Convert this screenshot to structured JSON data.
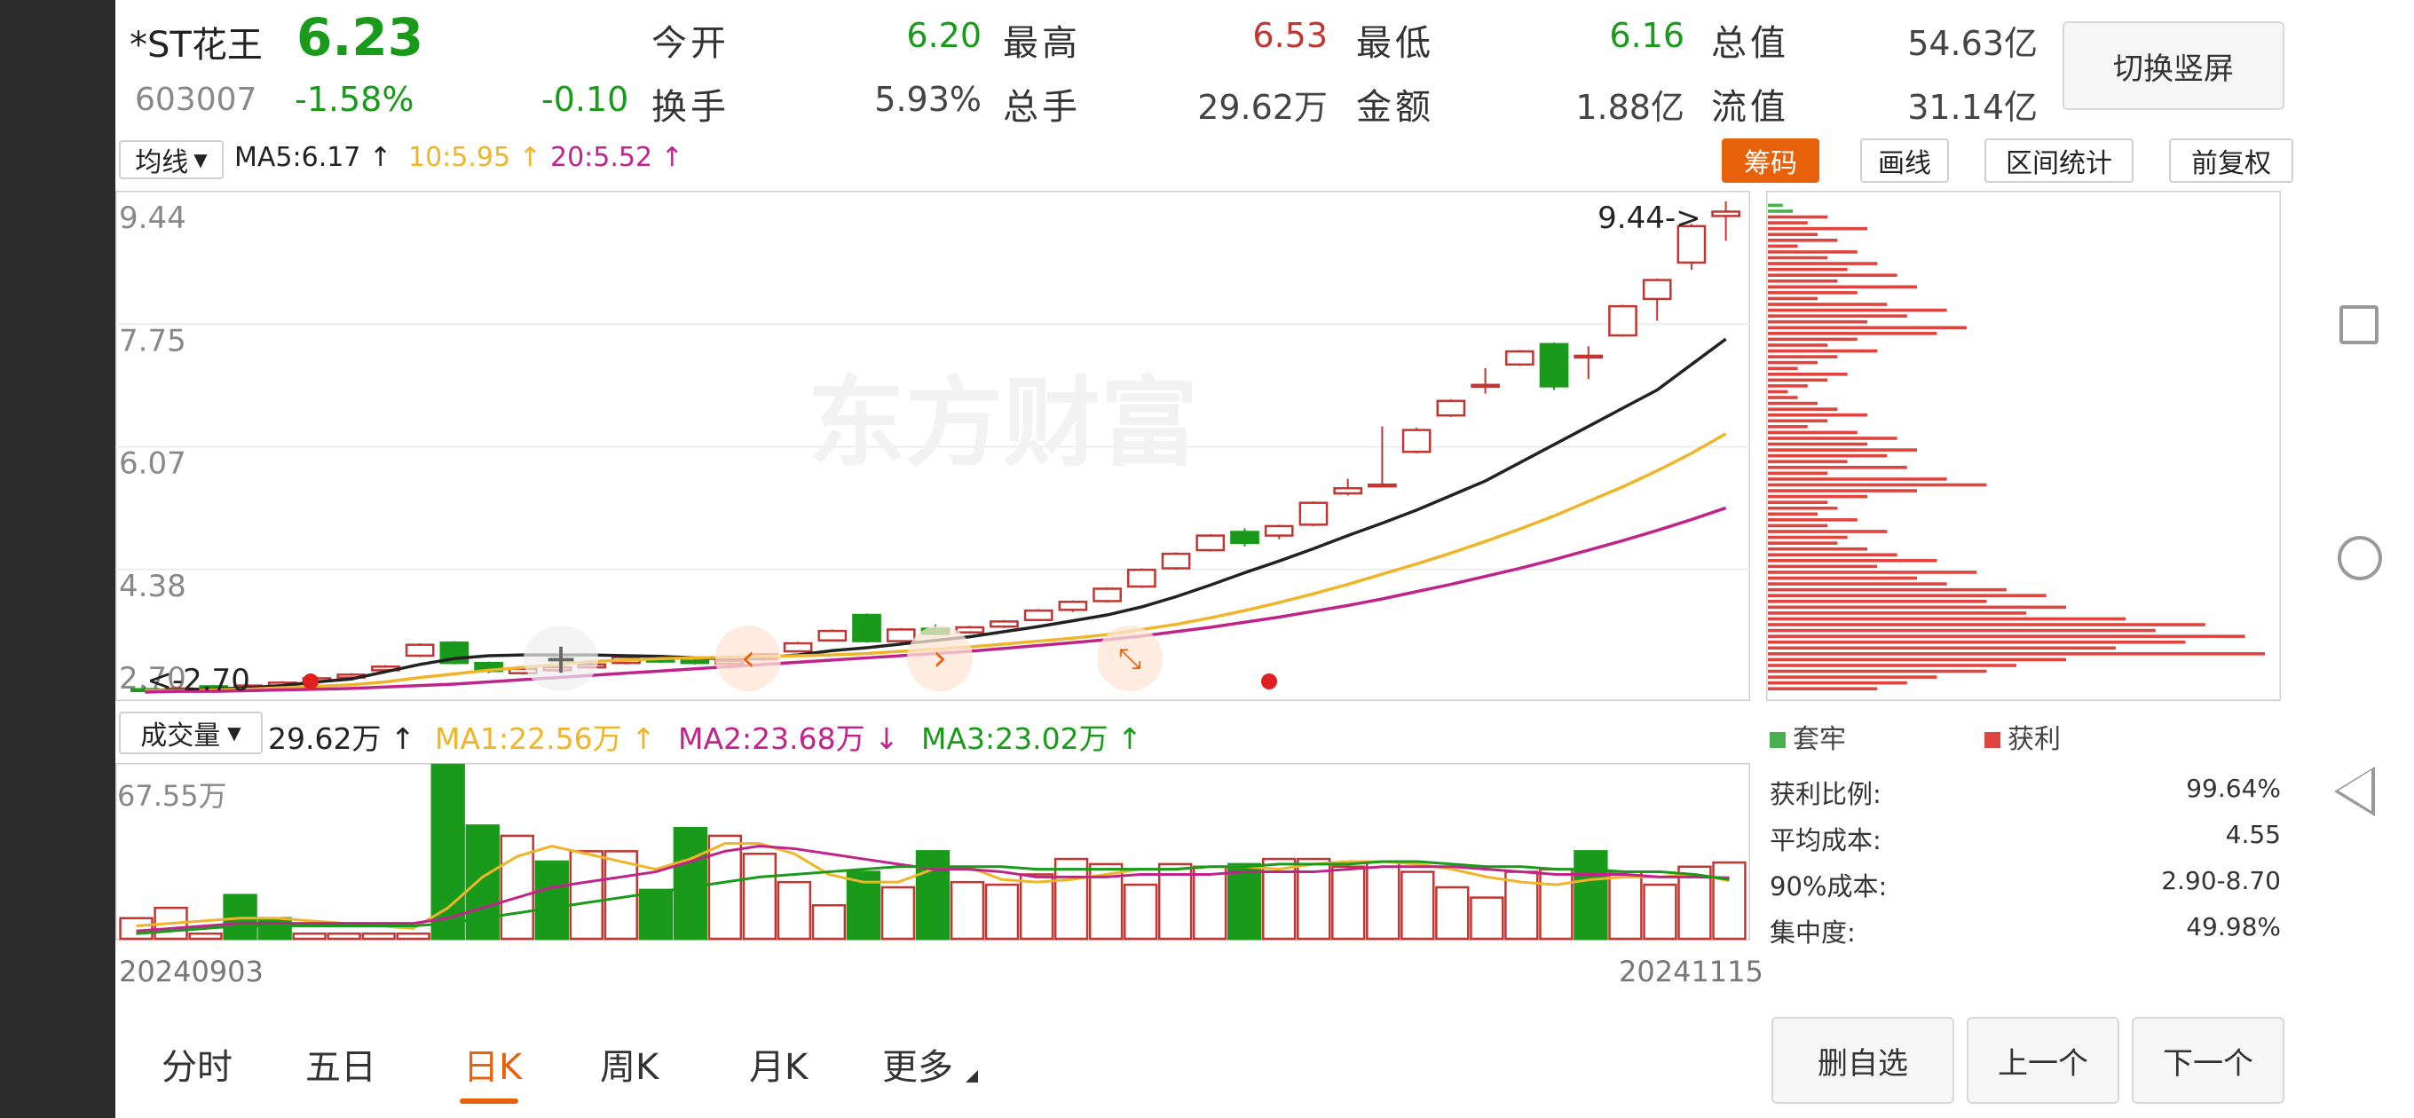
{
  "quote": {
    "name": "*ST花王",
    "price": "6.23",
    "code": "603007",
    "change_pct": "-1.58%",
    "change": "-0.10",
    "fields": [
      {
        "label": "今开",
        "value": "6.20",
        "color": "green"
      },
      {
        "label": "最高",
        "value": "6.53",
        "color": "red"
      },
      {
        "label": "最低",
        "value": "6.16",
        "color": "green"
      },
      {
        "label": "总值",
        "value": "54.63亿",
        "color": "gray"
      },
      {
        "label": "换手",
        "value": "5.93%",
        "color": "gray"
      },
      {
        "label": "总手",
        "value": "29.62万",
        "color": "gray"
      },
      {
        "label": "金额",
        "value": "1.88亿",
        "color": "gray"
      },
      {
        "label": "流值",
        "value": "31.14亿",
        "color": "gray"
      }
    ],
    "switch_button": "切换竖屏"
  },
  "ma_bar": {
    "selector": "均线",
    "ma5": "MA5:6.17",
    "ma10": "10:5.95",
    "ma20": "20:5.52",
    "buttons": [
      "筹码",
      "画线",
      "区间统计",
      "前复权"
    ]
  },
  "kline": {
    "y_labels": [
      "9.44",
      "7.75",
      "6.07",
      "4.38",
      "2.70"
    ],
    "max_label": "9.44->",
    "min_label": "<-2.70",
    "watermark": "东方财富"
  },
  "volume_bar": {
    "selector": "成交量",
    "vol": "29.62万",
    "ma1": "MA1:22.56万",
    "ma2": "MA2:23.68万",
    "ma3": "MA3:23.02万",
    "y_label": "67.55万",
    "date_start": "20240903",
    "date_end": "20241115"
  },
  "chips": {
    "legend_loss": "套牢",
    "legend_profit": "获利",
    "stats": [
      {
        "label": "获利比例:",
        "value": "99.64%"
      },
      {
        "label": "平均成本:",
        "value": "4.55"
      },
      {
        "label": "90%成本:",
        "value": "2.90-8.70"
      },
      {
        "label": "集中度:",
        "value": "49.98%"
      }
    ]
  },
  "tabs": [
    "分时",
    "五日",
    "日K",
    "周K",
    "月K",
    "更多"
  ],
  "active_tab": "日K",
  "bottom_buttons": [
    "删自选",
    "上一个",
    "下一个"
  ],
  "colors": {
    "up": "#c23531",
    "down": "#1a9a1a",
    "ma5": "#222222",
    "ma10": "#f0b429",
    "ma20": "#c0248a",
    "accent": "#e8620c"
  },
  "chart_data": {
    "type": "candlestick",
    "x_range": [
      "20240903",
      "20241115"
    ],
    "ylim": [
      2.7,
      9.44
    ],
    "candles": [
      {
        "o": 2.74,
        "c": 2.72,
        "h": 2.78,
        "l": 2.7
      },
      {
        "o": 2.72,
        "c": 2.75,
        "h": 2.77,
        "l": 2.7
      },
      {
        "o": 2.78,
        "c": 2.74,
        "h": 2.8,
        "l": 2.73
      },
      {
        "o": 2.74,
        "c": 2.79,
        "h": 2.81,
        "l": 2.73
      },
      {
        "o": 2.79,
        "c": 2.83,
        "h": 2.85,
        "l": 2.78
      },
      {
        "o": 2.85,
        "c": 2.89,
        "h": 2.91,
        "l": 2.84
      },
      {
        "o": 2.9,
        "c": 2.94,
        "h": 2.96,
        "l": 2.88
      },
      {
        "o": 3.0,
        "c": 3.05,
        "h": 3.07,
        "l": 2.98
      },
      {
        "o": 3.2,
        "c": 3.35,
        "h": 3.37,
        "l": 3.18
      },
      {
        "o": 3.38,
        "c": 3.1,
        "h": 3.4,
        "l": 3.08
      },
      {
        "o": 3.1,
        "c": 2.99,
        "h": 3.12,
        "l": 2.96
      },
      {
        "o": 2.96,
        "c": 3.02,
        "h": 3.05,
        "l": 2.94
      },
      {
        "o": 3.0,
        "c": 3.04,
        "h": 3.08,
        "l": 2.98
      },
      {
        "o": 3.04,
        "c": 3.08,
        "h": 3.1,
        "l": 3.02
      },
      {
        "o": 3.1,
        "c": 3.18,
        "h": 3.2,
        "l": 3.08
      },
      {
        "o": 3.16,
        "c": 3.12,
        "h": 3.18,
        "l": 3.1
      },
      {
        "o": 3.13,
        "c": 3.1,
        "h": 3.15,
        "l": 3.08
      },
      {
        "o": 3.09,
        "c": 3.13,
        "h": 3.15,
        "l": 3.07
      },
      {
        "o": 3.15,
        "c": 3.22,
        "h": 3.24,
        "l": 3.13
      },
      {
        "o": 3.26,
        "c": 3.37,
        "h": 3.39,
        "l": 3.25
      },
      {
        "o": 3.41,
        "c": 3.54,
        "h": 3.56,
        "l": 3.4
      },
      {
        "o": 3.76,
        "c": 3.4,
        "h": 3.78,
        "l": 3.38
      },
      {
        "o": 3.4,
        "c": 3.56,
        "h": 3.58,
        "l": 3.38
      },
      {
        "o": 3.57,
        "c": 3.5,
        "h": 3.63,
        "l": 3.48
      },
      {
        "o": 3.52,
        "c": 3.59,
        "h": 3.61,
        "l": 3.5
      },
      {
        "o": 3.6,
        "c": 3.67,
        "h": 3.69,
        "l": 3.58
      },
      {
        "o": 3.69,
        "c": 3.82,
        "h": 3.84,
        "l": 3.68
      },
      {
        "o": 3.83,
        "c": 3.94,
        "h": 3.96,
        "l": 3.8
      },
      {
        "o": 3.95,
        "c": 4.12,
        "h": 4.14,
        "l": 3.93
      },
      {
        "o": 4.15,
        "c": 4.38,
        "h": 4.4,
        "l": 4.13
      },
      {
        "o": 4.4,
        "c": 4.6,
        "h": 4.62,
        "l": 4.38
      },
      {
        "o": 4.65,
        "c": 4.85,
        "h": 4.87,
        "l": 4.63
      },
      {
        "o": 4.9,
        "c": 4.75,
        "h": 4.95,
        "l": 4.7
      },
      {
        "o": 4.85,
        "c": 4.98,
        "h": 5.0,
        "l": 4.8
      },
      {
        "o": 5.0,
        "c": 5.3,
        "h": 5.32,
        "l": 4.98
      },
      {
        "o": 5.43,
        "c": 5.5,
        "h": 5.63,
        "l": 5.4
      },
      {
        "o": 5.55,
        "c": 5.55,
        "h": 6.35,
        "l": 5.52
      },
      {
        "o": 6.0,
        "c": 6.3,
        "h": 6.33,
        "l": 5.98
      },
      {
        "o": 6.5,
        "c": 6.7,
        "h": 6.72,
        "l": 6.48
      },
      {
        "o": 6.9,
        "c": 6.92,
        "h": 7.15,
        "l": 6.8
      },
      {
        "o": 7.2,
        "c": 7.38,
        "h": 7.4,
        "l": 7.18
      },
      {
        "o": 7.48,
        "c": 6.9,
        "h": 7.5,
        "l": 6.85
      },
      {
        "o": 7.3,
        "c": 7.32,
        "h": 7.45,
        "l": 7.0
      },
      {
        "o": 7.6,
        "c": 8.0,
        "h": 8.02,
        "l": 7.58
      },
      {
        "o": 8.1,
        "c": 8.36,
        "h": 8.38,
        "l": 7.8
      },
      {
        "o": 8.6,
        "c": 9.1,
        "h": 9.13,
        "l": 8.5
      },
      {
        "o": 9.24,
        "c": 9.3,
        "h": 9.44,
        "l": 8.9
      }
    ],
    "ma5": [
      2.72,
      2.73,
      2.74,
      2.76,
      2.79,
      2.84,
      2.88,
      2.98,
      3.08,
      3.16,
      3.2,
      3.21,
      3.21,
      3.21,
      3.2,
      3.19,
      3.17,
      3.16,
      3.18,
      3.21,
      3.27,
      3.31,
      3.36,
      3.41,
      3.46,
      3.53,
      3.6,
      3.68,
      3.76,
      3.87,
      4.01,
      4.17,
      4.34,
      4.5,
      4.67,
      4.85,
      5.02,
      5.2,
      5.4,
      5.6,
      5.85,
      6.1,
      6.35,
      6.6,
      6.85,
      7.2,
      7.55
    ],
    "ma10": [
      2.72,
      2.72,
      2.73,
      2.74,
      2.76,
      2.78,
      2.8,
      2.84,
      2.9,
      2.95,
      3.0,
      3.04,
      3.08,
      3.12,
      3.14,
      3.16,
      3.17,
      3.18,
      3.19,
      3.2,
      3.21,
      3.23,
      3.26,
      3.29,
      3.32,
      3.36,
      3.4,
      3.44,
      3.49,
      3.56,
      3.63,
      3.72,
      3.82,
      3.93,
      4.05,
      4.18,
      4.32,
      4.46,
      4.61,
      4.77,
      4.94,
      5.12,
      5.32,
      5.52,
      5.74,
      5.98,
      6.25
    ],
    "ma20": [
      2.7,
      2.71,
      2.71,
      2.72,
      2.73,
      2.74,
      2.75,
      2.77,
      2.79,
      2.81,
      2.84,
      2.87,
      2.9,
      2.93,
      2.96,
      2.99,
      3.02,
      3.05,
      3.08,
      3.11,
      3.14,
      3.17,
      3.2,
      3.23,
      3.26,
      3.3,
      3.34,
      3.38,
      3.42,
      3.47,
      3.53,
      3.59,
      3.66,
      3.73,
      3.81,
      3.89,
      3.98,
      4.08,
      4.18,
      4.29,
      4.4,
      4.52,
      4.65,
      4.78,
      4.92,
      5.07,
      5.23
    ],
    "volume": [
      8,
      12,
      2,
      17,
      8,
      2,
      2,
      2,
      2,
      67.55,
      44,
      40,
      30,
      34,
      34,
      19,
      43,
      40,
      33,
      22,
      13,
      26,
      20,
      34,
      22,
      21,
      25,
      31,
      29,
      21,
      29,
      28,
      29,
      31,
      31,
      28,
      30,
      26,
      20,
      16,
      26,
      27,
      34,
      26,
      21,
      28,
      29.62
    ],
    "volume_up": [
      1,
      1,
      1,
      0,
      0,
      1,
      1,
      1,
      1,
      0,
      0,
      1,
      0,
      1,
      1,
      0,
      0,
      1,
      1,
      1,
      1,
      0,
      1,
      0,
      1,
      1,
      1,
      1,
      1,
      1,
      1,
      1,
      0,
      1,
      1,
      1,
      1,
      1,
      1,
      1,
      1,
      1,
      0,
      1,
      1,
      1,
      1
    ],
    "vol_ma1": [
      5,
      6,
      7,
      8,
      8,
      7,
      6,
      5,
      4,
      12,
      24,
      32,
      36,
      33,
      30,
      27,
      31,
      37,
      37,
      33,
      25,
      22,
      22,
      27,
      28,
      23,
      22,
      23,
      25,
      27,
      27,
      28,
      28,
      27,
      29,
      30,
      30,
      29,
      27,
      24,
      22,
      21,
      23,
      24,
      24,
      25,
      22.56
    ],
    "vol_ma2": [
      3,
      4,
      5,
      6,
      6,
      6,
      6,
      6,
      6,
      8,
      12,
      16,
      20,
      22,
      24,
      26,
      30,
      34,
      36,
      35,
      33,
      31,
      29,
      27,
      27,
      26,
      24,
      24,
      24,
      25,
      25,
      25,
      26,
      26,
      26,
      27,
      28,
      28,
      28,
      27,
      26,
      25,
      25,
      25,
      24,
      24,
      23.68
    ],
    "vol_ma3": [
      2,
      3,
      4,
      5,
      5,
      5,
      5,
      5,
      5,
      6,
      8,
      10,
      12,
      14,
      16,
      18,
      20,
      22,
      24,
      25,
      26,
      27,
      28,
      28,
      28,
      28,
      27,
      27,
      27,
      27,
      27,
      28,
      28,
      29,
      29,
      29,
      30,
      30,
      29,
      28,
      28,
      27,
      27,
      26,
      26,
      25,
      23.02
    ],
    "chip_rows": [
      {
        "p": 9.38,
        "v": 3,
        "g": 1
      },
      {
        "p": 9.3,
        "v": 5,
        "g": 1
      },
      {
        "p": 9.22,
        "v": 12
      },
      {
        "p": 9.14,
        "v": 8
      },
      {
        "p": 9.06,
        "v": 20
      },
      {
        "p": 8.98,
        "v": 10
      },
      {
        "p": 8.9,
        "v": 14
      },
      {
        "p": 8.82,
        "v": 6
      },
      {
        "p": 8.74,
        "v": 18
      },
      {
        "p": 8.66,
        "v": 12
      },
      {
        "p": 8.58,
        "v": 22
      },
      {
        "p": 8.5,
        "v": 16
      },
      {
        "p": 8.42,
        "v": 26
      },
      {
        "p": 8.34,
        "v": 14
      },
      {
        "p": 8.26,
        "v": 30
      },
      {
        "p": 8.18,
        "v": 18
      },
      {
        "p": 8.1,
        "v": 10
      },
      {
        "p": 8.02,
        "v": 24
      },
      {
        "p": 7.94,
        "v": 36
      },
      {
        "p": 7.86,
        "v": 28
      },
      {
        "p": 7.78,
        "v": 20
      },
      {
        "p": 7.7,
        "v": 40
      },
      {
        "p": 7.62,
        "v": 34
      },
      {
        "p": 7.54,
        "v": 18
      },
      {
        "p": 7.46,
        "v": 12
      },
      {
        "p": 7.38,
        "v": 22
      },
      {
        "p": 7.3,
        "v": 14
      },
      {
        "p": 7.22,
        "v": 10
      },
      {
        "p": 7.14,
        "v": 6
      },
      {
        "p": 7.06,
        "v": 16
      },
      {
        "p": 6.98,
        "v": 12
      },
      {
        "p": 6.9,
        "v": 8
      },
      {
        "p": 6.82,
        "v": 4
      },
      {
        "p": 6.74,
        "v": 6
      },
      {
        "p": 6.66,
        "v": 10
      },
      {
        "p": 6.58,
        "v": 14
      },
      {
        "p": 6.5,
        "v": 20
      },
      {
        "p": 6.42,
        "v": 12
      },
      {
        "p": 6.34,
        "v": 8
      },
      {
        "p": 6.26,
        "v": 18
      },
      {
        "p": 6.18,
        "v": 26
      },
      {
        "p": 6.1,
        "v": 20
      },
      {
        "p": 6.02,
        "v": 30
      },
      {
        "p": 5.94,
        "v": 24
      },
      {
        "p": 5.86,
        "v": 16
      },
      {
        "p": 5.78,
        "v": 28
      },
      {
        "p": 5.7,
        "v": 12
      },
      {
        "p": 5.62,
        "v": 36
      },
      {
        "p": 5.54,
        "v": 44
      },
      {
        "p": 5.46,
        "v": 30
      },
      {
        "p": 5.38,
        "v": 20
      },
      {
        "p": 5.3,
        "v": 12
      },
      {
        "p": 5.22,
        "v": 14
      },
      {
        "p": 5.14,
        "v": 10
      },
      {
        "p": 5.06,
        "v": 18
      },
      {
        "p": 4.98,
        "v": 12
      },
      {
        "p": 4.9,
        "v": 24
      },
      {
        "p": 4.82,
        "v": 16
      },
      {
        "p": 4.74,
        "v": 14
      },
      {
        "p": 4.66,
        "v": 20
      },
      {
        "p": 4.58,
        "v": 26
      },
      {
        "p": 4.5,
        "v": 34
      },
      {
        "p": 4.42,
        "v": 22
      },
      {
        "p": 4.34,
        "v": 42
      },
      {
        "p": 4.26,
        "v": 30
      },
      {
        "p": 4.18,
        "v": 36
      },
      {
        "p": 4.1,
        "v": 48
      },
      {
        "p": 4.02,
        "v": 56
      },
      {
        "p": 3.94,
        "v": 44
      },
      {
        "p": 3.86,
        "v": 60
      },
      {
        "p": 3.78,
        "v": 52
      },
      {
        "p": 3.7,
        "v": 72
      },
      {
        "p": 3.62,
        "v": 88
      },
      {
        "p": 3.54,
        "v": 78
      },
      {
        "p": 3.46,
        "v": 96
      },
      {
        "p": 3.38,
        "v": 84
      },
      {
        "p": 3.3,
        "v": 70
      },
      {
        "p": 3.22,
        "v": 100
      },
      {
        "p": 3.14,
        "v": 60
      },
      {
        "p": 3.06,
        "v": 50
      },
      {
        "p": 2.98,
        "v": 44
      },
      {
        "p": 2.9,
        "v": 34
      },
      {
        "p": 2.82,
        "v": 28
      },
      {
        "p": 2.74,
        "v": 22
      }
    ]
  }
}
